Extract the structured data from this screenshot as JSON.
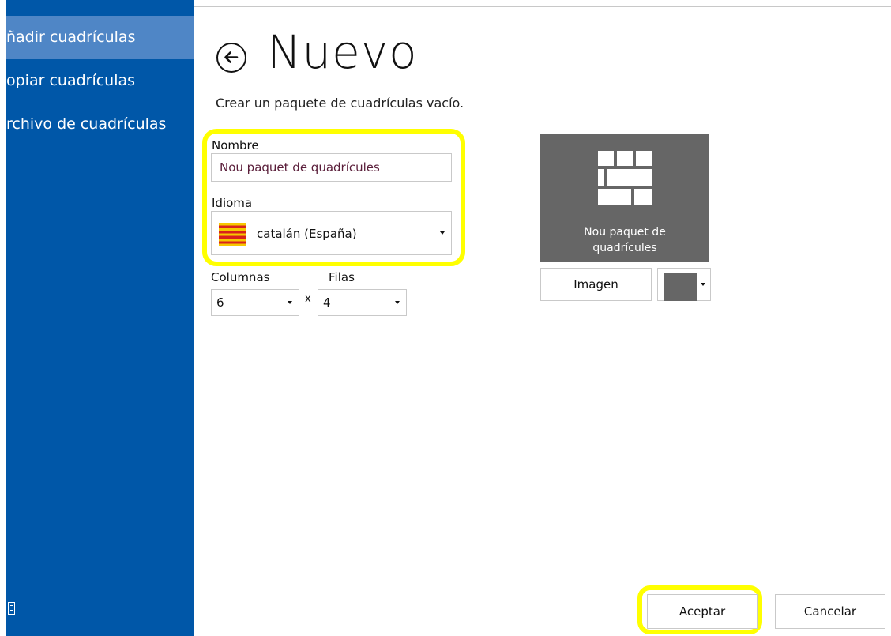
{
  "sidebar": {
    "items": [
      {
        "label": "ñadir cuadrículas"
      },
      {
        "label": "opiar cuadrículas"
      },
      {
        "label": "rchivo de cuadrículas"
      }
    ]
  },
  "header": {
    "title": "Nuevo",
    "subtitle": "Crear un paquete de cuadrículas vacío."
  },
  "form": {
    "name_label": "Nombre",
    "name_value": "Nou paquet de quadrícules",
    "language_label": "Idioma",
    "language_value": "catalán (España)",
    "columns_label": "Columnas",
    "columns_value": "6",
    "rows_label": "Filas",
    "rows_value": "4",
    "times_symbol": "x"
  },
  "preview": {
    "tile_line1": "Nou paquet de",
    "tile_line2": "quadrícules",
    "image_button": "Imagen",
    "color": "#666666"
  },
  "footer": {
    "ok_label": "Aceptar",
    "cancel_label": "Cancelar"
  },
  "colors": {
    "sidebar": "#0057a8",
    "sidebar_active": "#4f86c6",
    "highlight": "#ffff00"
  },
  "icons": {
    "back": "arrow-left-circle-icon",
    "tile": "grid-tiles-icon",
    "flag": "catalan-flag-icon"
  }
}
